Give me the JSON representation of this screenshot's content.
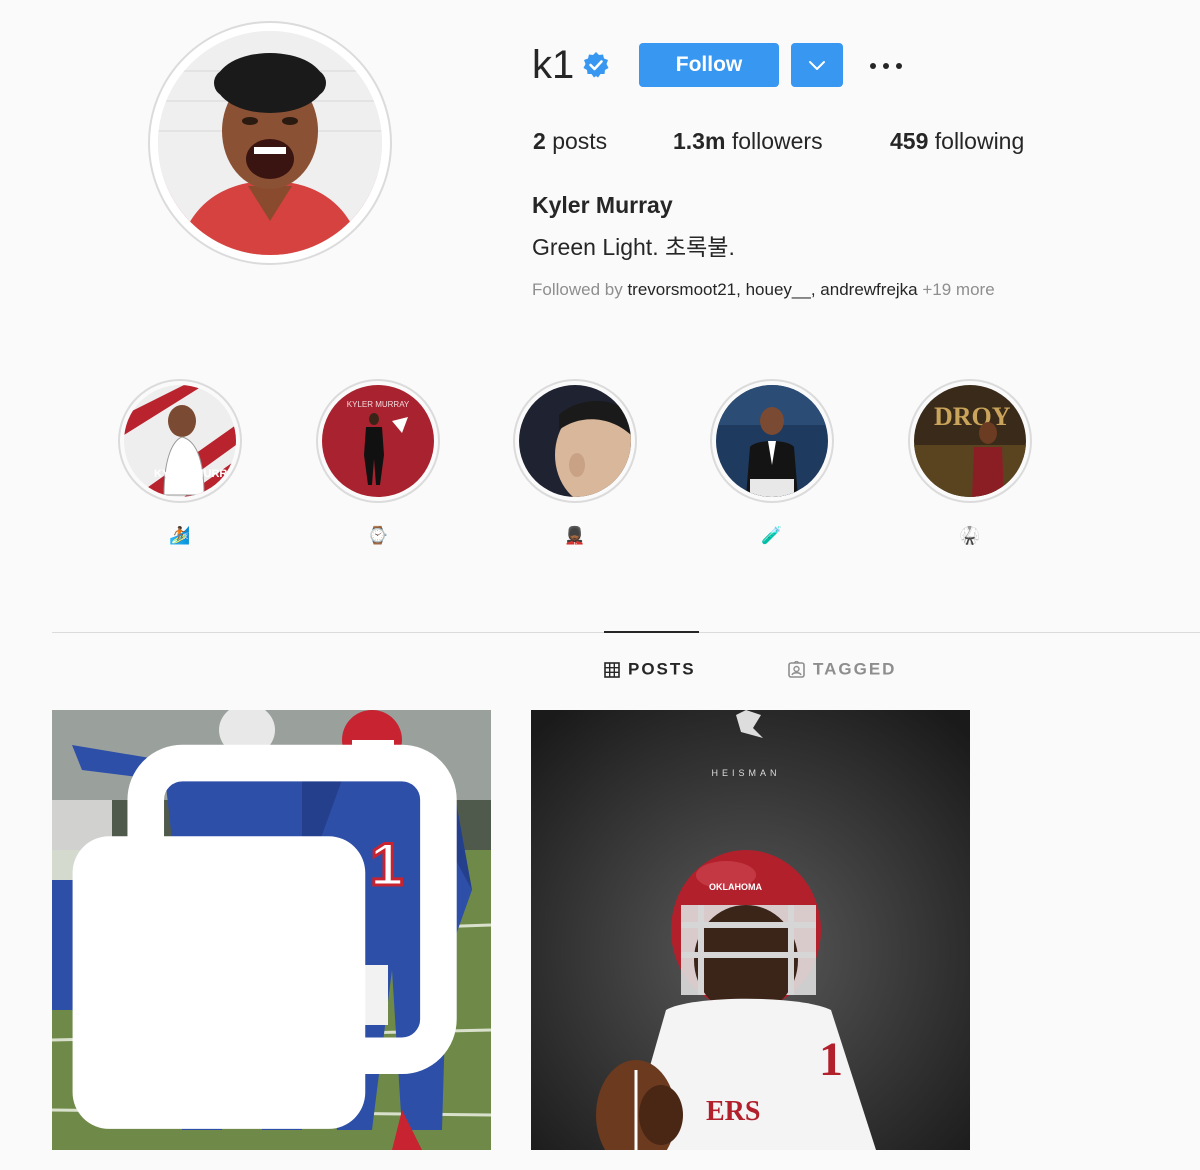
{
  "profile": {
    "username": "k1",
    "verified": true,
    "follow_label": "Follow",
    "full_name": "Kyler Murray",
    "bio": "Green Light. 초록불."
  },
  "stats": {
    "posts": {
      "count": "2",
      "label": "posts"
    },
    "followers": {
      "count": "1.3m",
      "label": "followers"
    },
    "following": {
      "count": "459",
      "label": "following"
    }
  },
  "followed_by": {
    "prefix": "Followed by",
    "names": [
      "trevorsmoot21",
      "houey__",
      "andrewfrejka"
    ],
    "more": "+19 more"
  },
  "highlights": [
    {
      "label": "🏄🏾"
    },
    {
      "label": "⌚"
    },
    {
      "label": "💂🏾"
    },
    {
      "label": "🧪"
    },
    {
      "label": "🥋"
    }
  ],
  "highlight_texts": {
    "h1": "KYLER MURRAY",
    "h2": "KYLER MURRAY",
    "h5": "DROY"
  },
  "tabs": {
    "posts": "POSTS",
    "tagged": "TAGGED"
  },
  "posts": {
    "post1_jersey": "1",
    "post2_header": "HEISMAN",
    "post2_jersey": "1",
    "post2_helmet_text": "OKLAHOMA",
    "post2_chest_text": "ERS"
  },
  "colors": {
    "accent": "#3897f0",
    "verified": "#3897f0",
    "text": "#262626",
    "muted": "#8e8e8e",
    "background": "#fafafa",
    "border": "#dbdbdb"
  }
}
